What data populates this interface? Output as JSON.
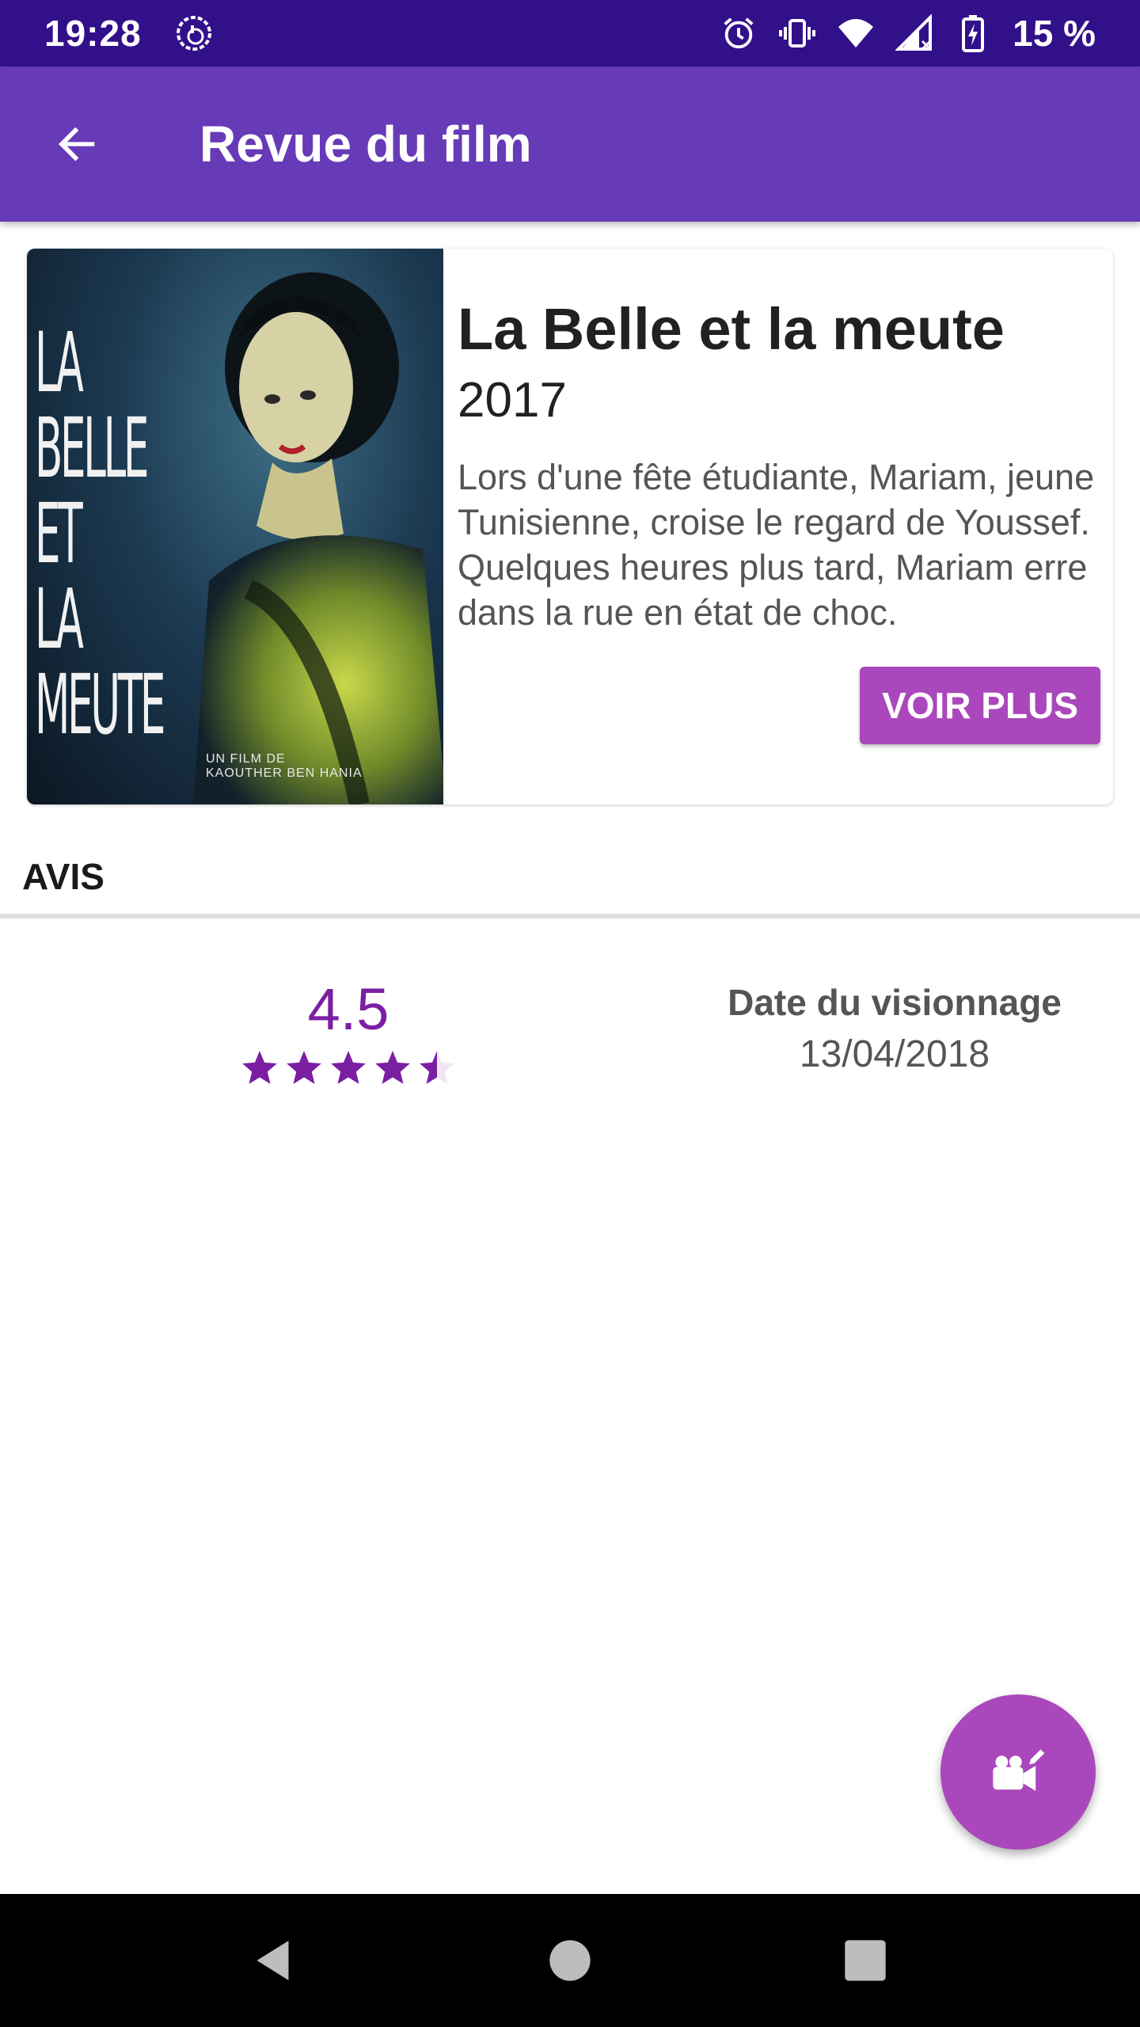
{
  "status_bar": {
    "time": "19:28",
    "battery": "15 %",
    "icons": [
      "podcast-icon",
      "alarm-icon",
      "vibrate-icon",
      "wifi-icon",
      "signal-icon",
      "battery-icon"
    ]
  },
  "app_bar": {
    "title": "Revue du film",
    "back_icon": "arrow-back-icon"
  },
  "movie": {
    "title": "La Belle et la meute",
    "year": "2017",
    "synopsis": "Lors d'une fête étudiante, Mariam, jeune Tunisienne, croise le regard de Youssef.  Quelques heures plus tard, Mariam erre dans la rue en état de choc.",
    "poster_text": "LA\nBELLE\nET\nLA\nMEUTE",
    "poster_credit": "UN FILM DE\nKAOUTHER BEN HANIA",
    "voir_plus_label": "VOIR PLUS"
  },
  "review": {
    "section_title": "AVIS",
    "rating": "4.5",
    "rating_value": 4.5,
    "rating_max": 5,
    "date_label": "Date du visionnage",
    "date_value": "13/04/2018"
  },
  "fab": {
    "icon": "video-camera-edit-icon"
  },
  "nav": {
    "icons": [
      "back-triangle-icon",
      "home-circle-icon",
      "recents-square-icon"
    ]
  },
  "colors": {
    "status_bar": "#32108a",
    "app_bar": "#673ab7",
    "accent": "#ab47bc",
    "rating": "#7b1fa2"
  }
}
